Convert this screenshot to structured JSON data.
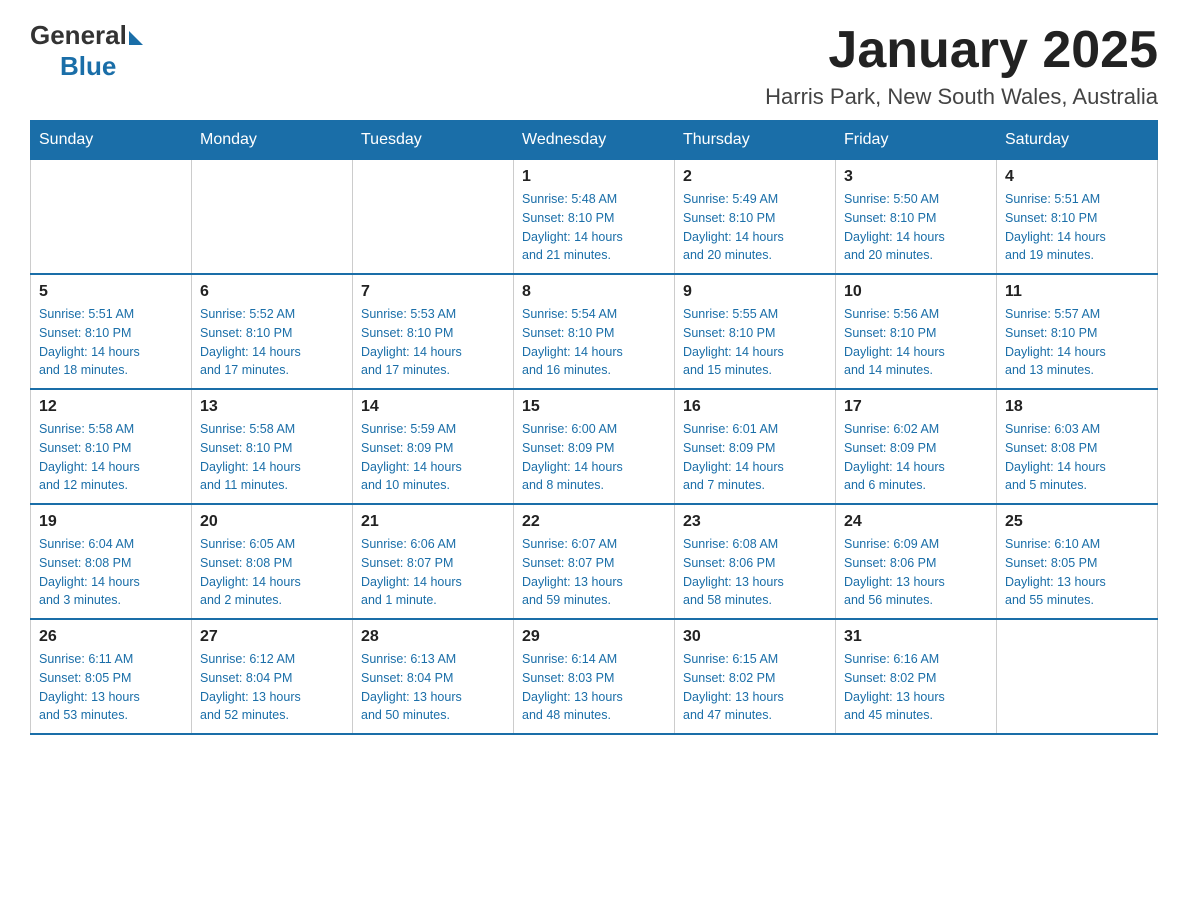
{
  "logo": {
    "text_general": "General",
    "text_blue": "Blue"
  },
  "title": "January 2025",
  "subtitle": "Harris Park, New South Wales, Australia",
  "days_of_week": [
    "Sunday",
    "Monday",
    "Tuesday",
    "Wednesday",
    "Thursday",
    "Friday",
    "Saturday"
  ],
  "weeks": [
    [
      {
        "day": "",
        "info": ""
      },
      {
        "day": "",
        "info": ""
      },
      {
        "day": "",
        "info": ""
      },
      {
        "day": "1",
        "info": "Sunrise: 5:48 AM\nSunset: 8:10 PM\nDaylight: 14 hours\nand 21 minutes."
      },
      {
        "day": "2",
        "info": "Sunrise: 5:49 AM\nSunset: 8:10 PM\nDaylight: 14 hours\nand 20 minutes."
      },
      {
        "day": "3",
        "info": "Sunrise: 5:50 AM\nSunset: 8:10 PM\nDaylight: 14 hours\nand 20 minutes."
      },
      {
        "day": "4",
        "info": "Sunrise: 5:51 AM\nSunset: 8:10 PM\nDaylight: 14 hours\nand 19 minutes."
      }
    ],
    [
      {
        "day": "5",
        "info": "Sunrise: 5:51 AM\nSunset: 8:10 PM\nDaylight: 14 hours\nand 18 minutes."
      },
      {
        "day": "6",
        "info": "Sunrise: 5:52 AM\nSunset: 8:10 PM\nDaylight: 14 hours\nand 17 minutes."
      },
      {
        "day": "7",
        "info": "Sunrise: 5:53 AM\nSunset: 8:10 PM\nDaylight: 14 hours\nand 17 minutes."
      },
      {
        "day": "8",
        "info": "Sunrise: 5:54 AM\nSunset: 8:10 PM\nDaylight: 14 hours\nand 16 minutes."
      },
      {
        "day": "9",
        "info": "Sunrise: 5:55 AM\nSunset: 8:10 PM\nDaylight: 14 hours\nand 15 minutes."
      },
      {
        "day": "10",
        "info": "Sunrise: 5:56 AM\nSunset: 8:10 PM\nDaylight: 14 hours\nand 14 minutes."
      },
      {
        "day": "11",
        "info": "Sunrise: 5:57 AM\nSunset: 8:10 PM\nDaylight: 14 hours\nand 13 minutes."
      }
    ],
    [
      {
        "day": "12",
        "info": "Sunrise: 5:58 AM\nSunset: 8:10 PM\nDaylight: 14 hours\nand 12 minutes."
      },
      {
        "day": "13",
        "info": "Sunrise: 5:58 AM\nSunset: 8:10 PM\nDaylight: 14 hours\nand 11 minutes."
      },
      {
        "day": "14",
        "info": "Sunrise: 5:59 AM\nSunset: 8:09 PM\nDaylight: 14 hours\nand 10 minutes."
      },
      {
        "day": "15",
        "info": "Sunrise: 6:00 AM\nSunset: 8:09 PM\nDaylight: 14 hours\nand 8 minutes."
      },
      {
        "day": "16",
        "info": "Sunrise: 6:01 AM\nSunset: 8:09 PM\nDaylight: 14 hours\nand 7 minutes."
      },
      {
        "day": "17",
        "info": "Sunrise: 6:02 AM\nSunset: 8:09 PM\nDaylight: 14 hours\nand 6 minutes."
      },
      {
        "day": "18",
        "info": "Sunrise: 6:03 AM\nSunset: 8:08 PM\nDaylight: 14 hours\nand 5 minutes."
      }
    ],
    [
      {
        "day": "19",
        "info": "Sunrise: 6:04 AM\nSunset: 8:08 PM\nDaylight: 14 hours\nand 3 minutes."
      },
      {
        "day": "20",
        "info": "Sunrise: 6:05 AM\nSunset: 8:08 PM\nDaylight: 14 hours\nand 2 minutes."
      },
      {
        "day": "21",
        "info": "Sunrise: 6:06 AM\nSunset: 8:07 PM\nDaylight: 14 hours\nand 1 minute."
      },
      {
        "day": "22",
        "info": "Sunrise: 6:07 AM\nSunset: 8:07 PM\nDaylight: 13 hours\nand 59 minutes."
      },
      {
        "day": "23",
        "info": "Sunrise: 6:08 AM\nSunset: 8:06 PM\nDaylight: 13 hours\nand 58 minutes."
      },
      {
        "day": "24",
        "info": "Sunrise: 6:09 AM\nSunset: 8:06 PM\nDaylight: 13 hours\nand 56 minutes."
      },
      {
        "day": "25",
        "info": "Sunrise: 6:10 AM\nSunset: 8:05 PM\nDaylight: 13 hours\nand 55 minutes."
      }
    ],
    [
      {
        "day": "26",
        "info": "Sunrise: 6:11 AM\nSunset: 8:05 PM\nDaylight: 13 hours\nand 53 minutes."
      },
      {
        "day": "27",
        "info": "Sunrise: 6:12 AM\nSunset: 8:04 PM\nDaylight: 13 hours\nand 52 minutes."
      },
      {
        "day": "28",
        "info": "Sunrise: 6:13 AM\nSunset: 8:04 PM\nDaylight: 13 hours\nand 50 minutes."
      },
      {
        "day": "29",
        "info": "Sunrise: 6:14 AM\nSunset: 8:03 PM\nDaylight: 13 hours\nand 48 minutes."
      },
      {
        "day": "30",
        "info": "Sunrise: 6:15 AM\nSunset: 8:02 PM\nDaylight: 13 hours\nand 47 minutes."
      },
      {
        "day": "31",
        "info": "Sunrise: 6:16 AM\nSunset: 8:02 PM\nDaylight: 13 hours\nand 45 minutes."
      },
      {
        "day": "",
        "info": ""
      }
    ]
  ]
}
